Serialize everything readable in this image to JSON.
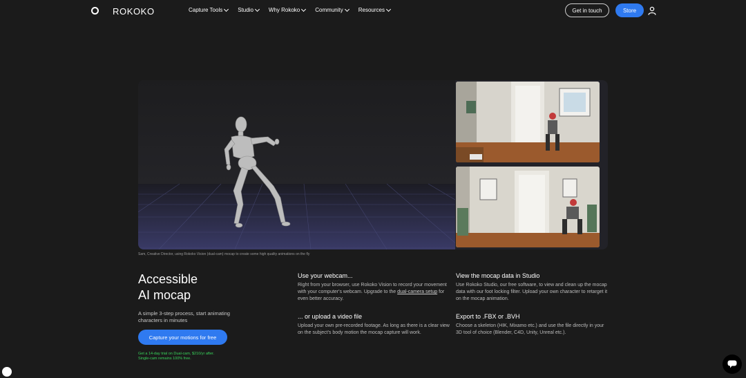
{
  "nav": {
    "logo": "ROKOKO",
    "menu": [
      {
        "label": "Capture Tools"
      },
      {
        "label": "Studio"
      },
      {
        "label": "Why Rokoko"
      },
      {
        "label": "Community"
      },
      {
        "label": "Resources"
      }
    ],
    "touch_label": "Get in touch",
    "store_label": "Store"
  },
  "media": {
    "caption": "Sam, Creative Director, using Rokoko Vision (dual-cam) mocap to create some high quality animations on the fly"
  },
  "hero": {
    "title_line1": "Accessible",
    "title_line2": "AI mocap",
    "subtitle": "A simple 3-step process, start animating characters in minutes",
    "cta_label": "Capture your motions for free",
    "note_line1": "Get a 14-day trial on Dual-cam, $210/yr after.",
    "note_line2": "Single-cam remains 100% free."
  },
  "steps": {
    "webcam_title": "Use your webcam...",
    "webcam_text_a": "Right from your browser, use Rokoko Vision to record your movement with your computer's webcam. Upgrade to the ",
    "webcam_link": "dual-camera setup",
    "webcam_text_b": " for even better accuracy.",
    "upload_title": "... or upload a video file",
    "upload_text": "Upload your own pre-recorded footage. As long as there is a clear view on the subject's body motion the mocap capture will work.",
    "studio_title": "View the mocap data in Studio",
    "studio_text": "Use Rokoko Studio, our free software, to view and clean up the mocap data with our foot locking filter. Upload your own character to retarget it on the mocap animation.",
    "export_title": "Export to .FBX or .BVH",
    "export_text": "Choose a skeleton (HIK, Mixamo etc.) and use the file directly in your 3D tool of choice (Blender, C4D, Unity, Unreal etc.)."
  },
  "colors": {
    "accent": "#2f7af0",
    "note": "#38d35b",
    "background": "#1b1b1b"
  }
}
